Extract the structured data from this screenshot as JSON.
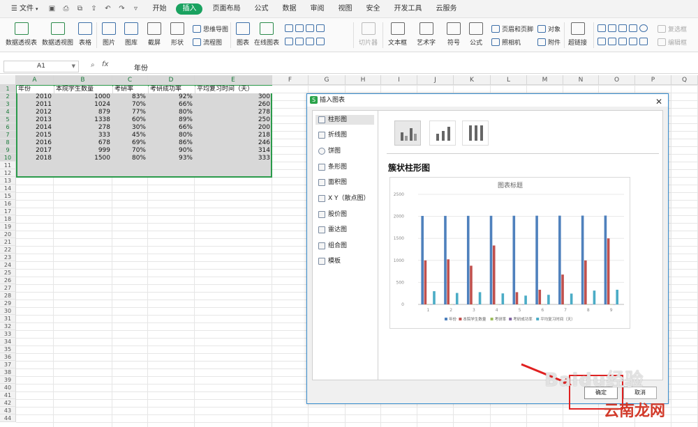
{
  "menubar": {
    "file": "文件",
    "tabs": [
      "开始",
      "插入",
      "页面布局",
      "公式",
      "数据",
      "审阅",
      "视图",
      "安全",
      "开发工具",
      "云服务"
    ],
    "active_tab": "插入"
  },
  "ribbon": {
    "buttons": [
      "数据透视表",
      "数据透视图",
      "表格",
      "图片",
      "图库",
      "截屏",
      "形状",
      "图表",
      "在线图表",
      "切片器",
      "文本框",
      "艺术字",
      "符号",
      "公式",
      "附件",
      "超链接"
    ],
    "small": {
      "mindmap": "思维导图",
      "flow": "流程图",
      "header_footer": "页眉和页脚",
      "object": "对象",
      "camera": "照相机",
      "check": "复选框",
      "edit": "编辑框"
    }
  },
  "formula_bar": {
    "cell_ref": "A1",
    "fx": "fx",
    "value": "年份"
  },
  "columns": [
    "A",
    "B",
    "C",
    "D",
    "E",
    "F",
    "G",
    "H",
    "I",
    "J",
    "K",
    "L",
    "M",
    "N",
    "O",
    "P",
    "Q"
  ],
  "rows": [
    "1",
    "2",
    "3",
    "4",
    "5",
    "6",
    "7",
    "8",
    "9",
    "10",
    "11",
    "12",
    "13",
    "14",
    "15",
    "16",
    "17",
    "18",
    "19",
    "20",
    "21",
    "22",
    "23",
    "24",
    "25",
    "26",
    "27",
    "28",
    "29",
    "30",
    "31",
    "32",
    "33",
    "34",
    "35",
    "36",
    "37",
    "38",
    "39",
    "40",
    "41",
    "42",
    "43",
    "44"
  ],
  "table": {
    "headers": [
      "年份",
      "本院学生数量",
      "考研率",
      "考研成功率",
      "平均复习时间（天）"
    ],
    "rows": [
      [
        "2010",
        "1000",
        "83%",
        "92%",
        "300"
      ],
      [
        "2011",
        "1024",
        "70%",
        "66%",
        "260"
      ],
      [
        "2012",
        "879",
        "77%",
        "80%",
        "278"
      ],
      [
        "2013",
        "1338",
        "60%",
        "89%",
        "250"
      ],
      [
        "2014",
        "278",
        "30%",
        "66%",
        "200"
      ],
      [
        "2015",
        "333",
        "45%",
        "80%",
        "218"
      ],
      [
        "2016",
        "678",
        "69%",
        "86%",
        "246"
      ],
      [
        "2017",
        "999",
        "70%",
        "90%",
        "314"
      ],
      [
        "2018",
        "1500",
        "80%",
        "93%",
        "333"
      ]
    ]
  },
  "dialog": {
    "title": "插入图表",
    "types": [
      "柱形图",
      "折线图",
      "饼图",
      "条形图",
      "面积图",
      "X Y（散点图）",
      "股价图",
      "雷达图",
      "组合图",
      "模板"
    ],
    "selected_type": "柱形图",
    "subtype_name": "簇状柱形图",
    "ok": "确定",
    "cancel": "取消"
  },
  "chart_data": {
    "type": "bar",
    "title": "图表标题",
    "categories": [
      "1",
      "2",
      "3",
      "4",
      "5",
      "6",
      "7",
      "8",
      "9"
    ],
    "ylim": [
      0,
      2500
    ],
    "yticks": [
      "0",
      "500",
      "1000",
      "1500",
      "2000",
      "2500"
    ],
    "series": [
      {
        "name": "年份",
        "color": "#4f81bd",
        "values": [
          2010,
          2011,
          2012,
          2013,
          2014,
          2015,
          2016,
          2017,
          2018
        ]
      },
      {
        "name": "本院学生数量",
        "color": "#c0504d",
        "values": [
          1000,
          1024,
          879,
          1338,
          278,
          333,
          678,
          999,
          1500
        ]
      },
      {
        "name": "考研率",
        "color": "#9bbb59",
        "values": [
          0.83,
          0.7,
          0.77,
          0.6,
          0.3,
          0.45,
          0.69,
          0.7,
          0.8
        ]
      },
      {
        "name": "考研成功率",
        "color": "#8064a2",
        "values": [
          0.92,
          0.66,
          0.8,
          0.89,
          0.66,
          0.8,
          0.86,
          0.9,
          0.93
        ]
      },
      {
        "name": "平均复习时间（天）",
        "color": "#4bacc6",
        "values": [
          300,
          260,
          278,
          250,
          200,
          218,
          246,
          314,
          333
        ]
      }
    ],
    "legend_position": "bottom"
  },
  "watermark": {
    "line1": "Baidu经验",
    "line2": "云南龙网"
  }
}
